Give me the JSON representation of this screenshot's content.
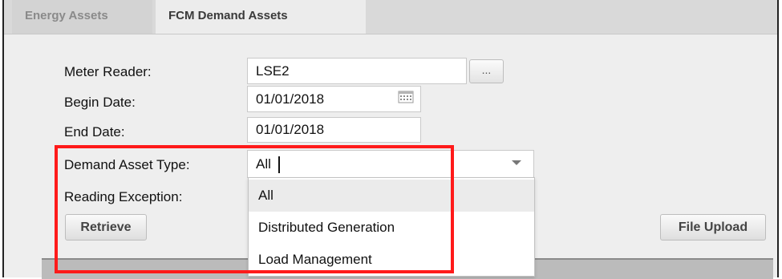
{
  "tabs": [
    {
      "label": "Energy Assets"
    },
    {
      "label": "FCM Demand Assets"
    }
  ],
  "form": {
    "meter_reader": {
      "label": "Meter Reader:",
      "value": "LSE2",
      "browse_label": "..."
    },
    "begin_date": {
      "label": "Begin Date:",
      "value": "01/01/2018"
    },
    "end_date": {
      "label": "End Date:",
      "value": "01/01/2018"
    },
    "demand_asset_type": {
      "label": "Demand Asset Type:",
      "value": "All"
    },
    "reading_exception": {
      "label": "Reading Exception:"
    }
  },
  "dropdown": {
    "options": [
      "All",
      "Distributed Generation",
      "Load Management"
    ],
    "selected": "All"
  },
  "buttons": {
    "retrieve": "Retrieve",
    "file_upload": "File Upload"
  },
  "colors": {
    "highlight": "#ff1a1a",
    "tabbar": "#d9d9d9",
    "background": "#eeeeee"
  }
}
